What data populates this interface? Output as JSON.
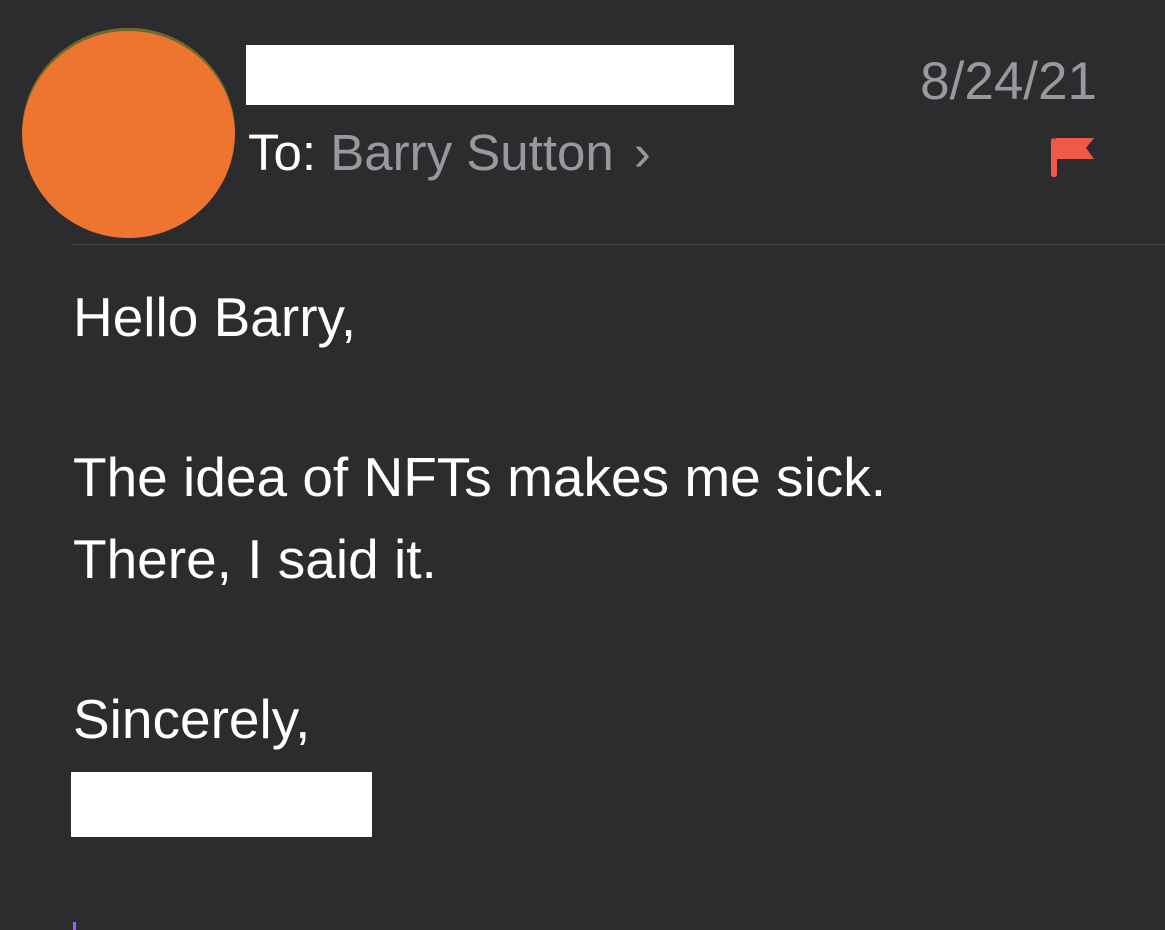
{
  "header": {
    "date": "8/24/21",
    "to_label": "To:",
    "recipient": "Barry Sutton",
    "chevron": "›"
  },
  "avatar": {
    "color": "#ee7530"
  },
  "flag": {
    "icon": "flag-icon",
    "color": "#ee5a47"
  },
  "body": {
    "greeting": "Hello Barry,",
    "line1": "The idea of NFTs makes me sick.",
    "line2": "There, I said it.",
    "closing": "Sincerely,"
  },
  "colors": {
    "background": "#2c2c2e",
    "secondary_text": "#98989d",
    "cursor": "#a259ff"
  }
}
